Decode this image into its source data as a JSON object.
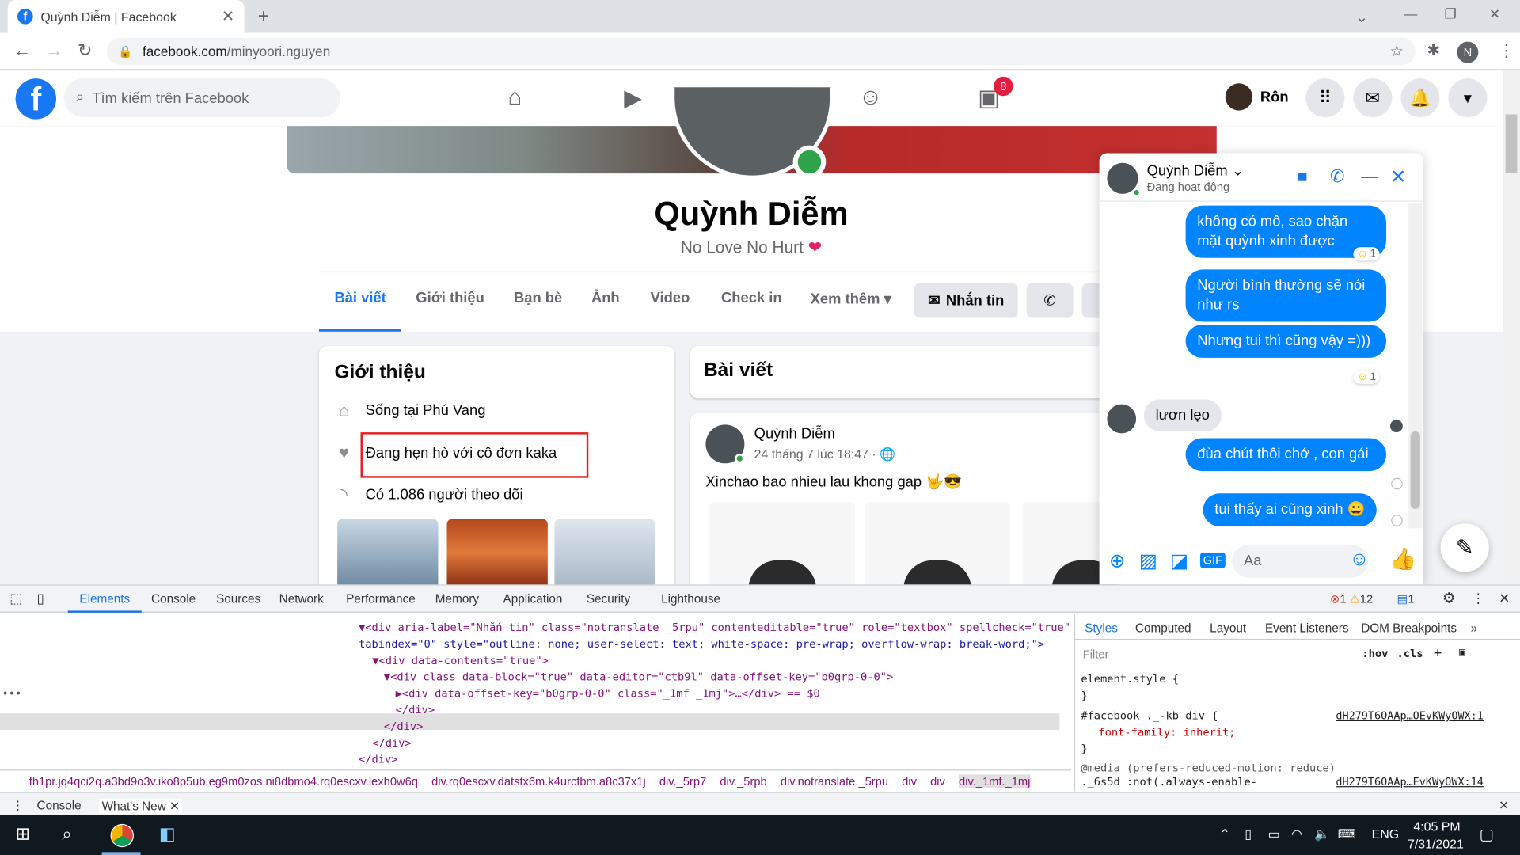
{
  "browser": {
    "tab_title": "Quỳnh Diễm | Facebook",
    "url_host": "facebook.com",
    "url_path": "/minyoori.nguyen",
    "profile_initial": "N"
  },
  "fb_header": {
    "search_placeholder": "Tìm kiếm trên Facebook",
    "notification_count": "8",
    "user_name": "Rôn"
  },
  "profile": {
    "name": "Quỳnh Diễm",
    "bio": "No Love No Hurt",
    "tabs": [
      "Bài viết",
      "Giới thiệu",
      "Bạn bè",
      "Ảnh",
      "Video",
      "Check in",
      "Xem thêm"
    ],
    "message_button": "Nhắn tin"
  },
  "intro": {
    "title": "Giới thiệu",
    "lives": "Sống tại Phú Vang",
    "relationship": "Đang hẹn hò với cô đơn kaka",
    "followers": "Có 1.086 người theo dõi"
  },
  "posts": {
    "title": "Bài viết",
    "author": "Quỳnh Diễm",
    "time": "24 tháng 7 lúc 18:47 ·",
    "text": "Xinchao bao nhieu lau khong gap 🤟😎"
  },
  "chat": {
    "name": "Quỳnh Diễm",
    "status": "Đang hoạt động",
    "messages": [
      {
        "text": "không có mô, sao chặn mặt quỳnh xinh được",
        "reaction": "1"
      },
      {
        "text": "Người bình thường sẽ nói như rs"
      },
      {
        "text": "Nhưng tui thì cũng vậy =)))",
        "reaction": "1"
      },
      {
        "text": "lươn lẹo"
      },
      {
        "text": "đùa chút thôi chớ , con gái"
      },
      {
        "text": "tui thấy ai cũng xinh 😀"
      }
    ],
    "input_placeholder": "Aa"
  },
  "devtools": {
    "tabs": [
      "Elements",
      "Console",
      "Sources",
      "Network",
      "Performance",
      "Memory",
      "Application",
      "Security",
      "Lighthouse"
    ],
    "errors": "1",
    "warnings": "12",
    "info": "1",
    "code_lines": [
      "▼<div aria-label=\"Nhắn tin\" class=\"notranslate _5rpu\" contenteditable=\"true\" role=\"textbox\" spellcheck=\"true\"",
      "tabindex=\"0\" style=\"outline: none; user-select: text; white-space: pre-wrap; overflow-wrap: break-word;\">",
      "▼<div data-contents=\"true\">",
      "▼<div class data-block=\"true\" data-editor=\"ctb9l\" data-offset-key=\"b0grp-0-0\">",
      "▶<div data-offset-key=\"b0grp-0-0\" class=\"_1mf _1mj\">…</div> == $0",
      "</div>",
      "</div>",
      "</div>",
      "</div>"
    ],
    "breadcrumbs": [
      "fh1pr.jq4qci2q.a3bd9o3v.iko8p5ub.eg9m0zos.ni8dbmo4.rq0escxv.lexh0w6q",
      "div.rq0escxv.datstx6m.k4urcfbm.a8c37x1j",
      "div._5rp7",
      "div._5rpb",
      "div.notranslate._5rpu",
      "div",
      "div",
      "div._1mf._1mj"
    ],
    "style_tabs": [
      "Styles",
      "Computed",
      "Layout",
      "Event Listeners",
      "DOM Breakpoints"
    ],
    "filter_placeholder": "Filter",
    "hov": ":hov",
    "cls": ".cls",
    "style_lines": [
      "element.style {",
      "}",
      "#facebook ._-kb div {",
      "font-family: inherit;",
      "}",
      "@media (prefers-reduced-motion: reduce)",
      "._6s5d :not(.always-enable-"
    ],
    "style_src1": "dH279T6OAAp…OEvKWyOWX:1",
    "style_src2": "dH279T6OAAp…EvKWyOWX:14",
    "drawer_tabs": [
      "Console",
      "What's New"
    ]
  },
  "taskbar": {
    "lang": "ENG",
    "time": "4:05 PM",
    "date": "7/31/2021"
  }
}
